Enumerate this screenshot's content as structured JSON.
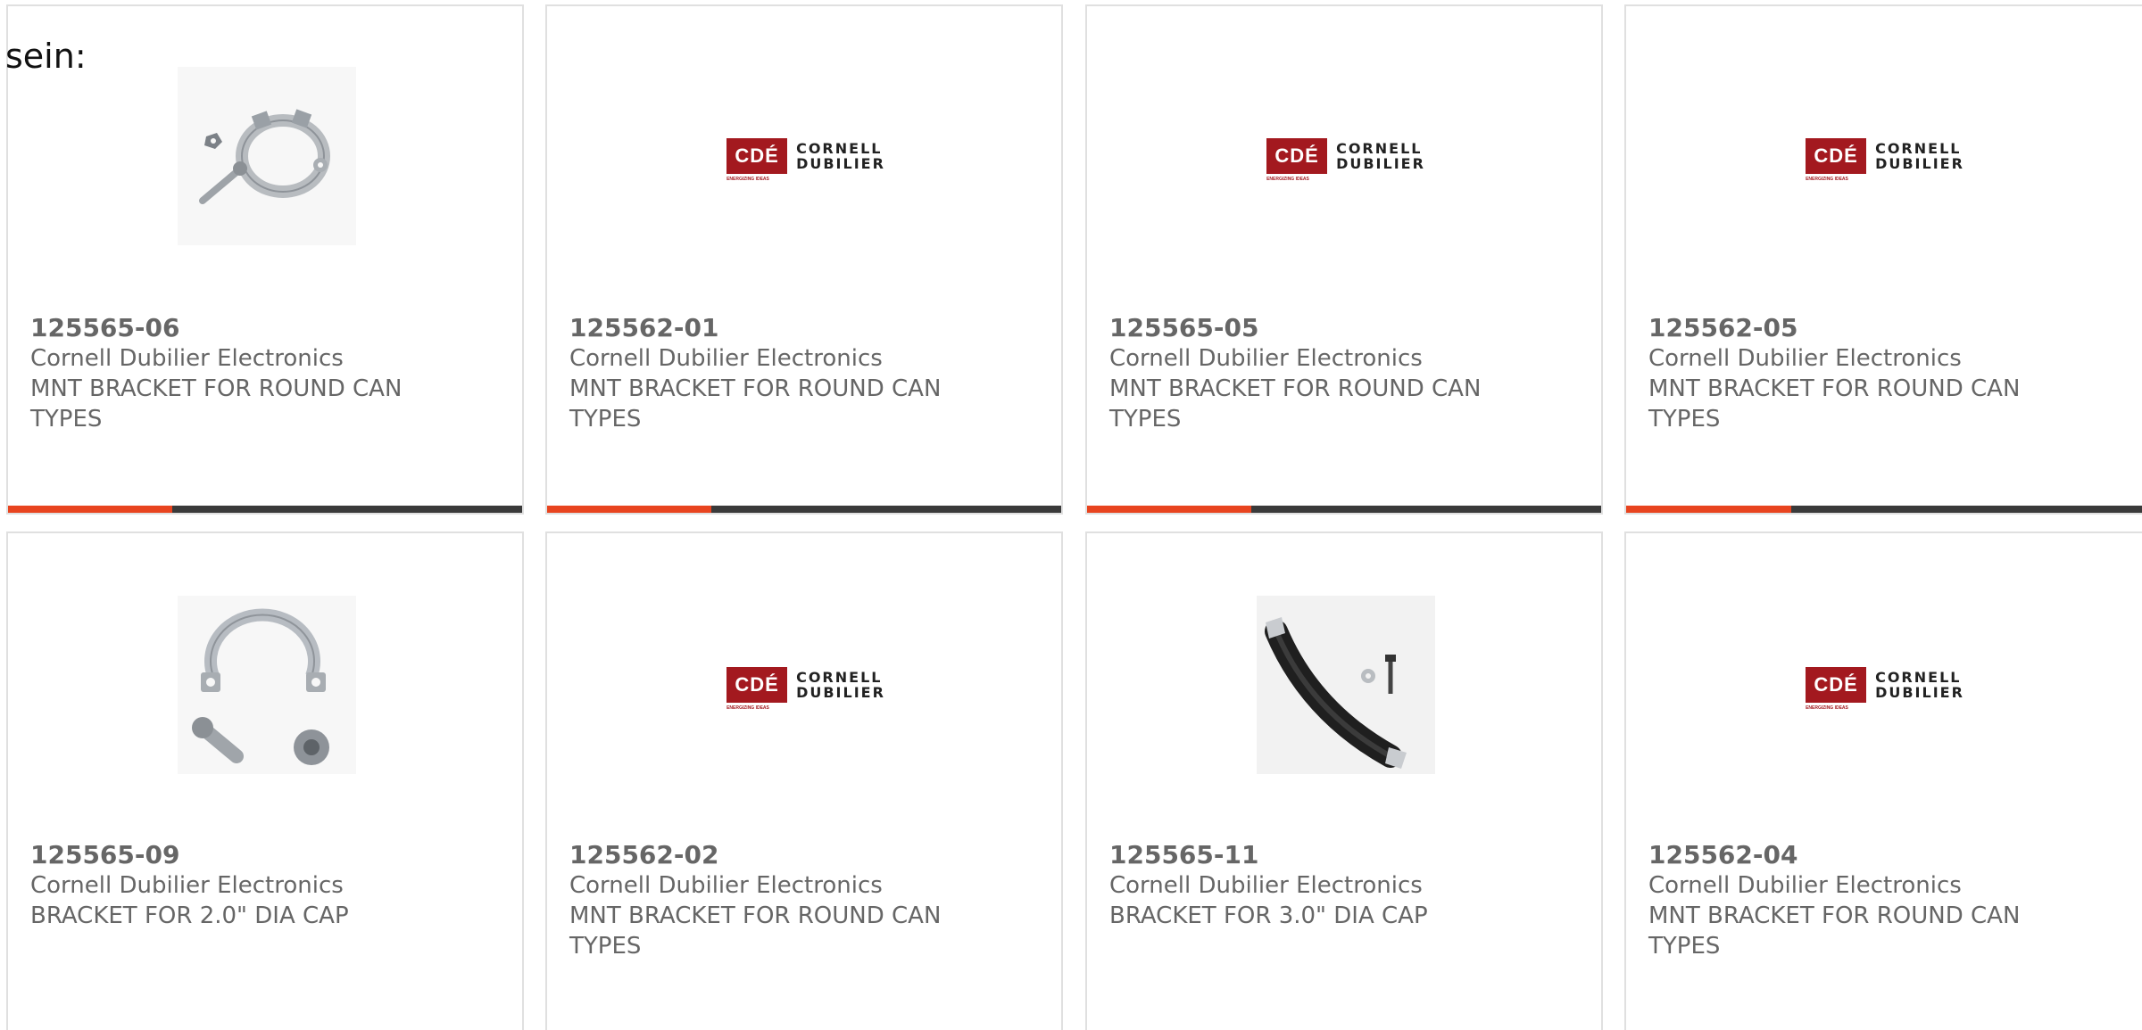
{
  "intro": "sein:",
  "colors": {
    "accent": "#e8441f",
    "track": "#3a3a3a",
    "cde_red": "#a3191f",
    "text_gray": "#666666"
  },
  "products": [
    {
      "part_number": "125565-06",
      "manufacturer": "Cornell Dubilier Electronics",
      "description": "MNT BRACKET FOR ROUND CAN TYPES",
      "image": "bracket-clamp-with-screw-photo",
      "progress": 0.32
    },
    {
      "part_number": "125562-01",
      "manufacturer": "Cornell Dubilier Electronics",
      "description": "MNT BRACKET FOR ROUND CAN TYPES",
      "image": "cde-logo",
      "logo": {
        "mark": "CDÉ",
        "line1": "CORNELL",
        "line2": "DUBILIER",
        "tagline": "ENERGIZING IDEAS"
      },
      "progress": 0.32
    },
    {
      "part_number": "125565-05",
      "manufacturer": "Cornell Dubilier Electronics",
      "description": "MNT BRACKET FOR ROUND CAN TYPES",
      "image": "cde-logo",
      "logo": {
        "mark": "CDÉ",
        "line1": "CORNELL",
        "line2": "DUBILIER",
        "tagline": "ENERGIZING IDEAS"
      },
      "progress": 0.32
    },
    {
      "part_number": "125562-05",
      "manufacturer": "Cornell Dubilier Electronics",
      "description": "MNT BRACKET FOR ROUND CAN TYPES",
      "image": "cde-logo",
      "logo": {
        "mark": "CDÉ",
        "line1": "CORNELL",
        "line2": "DUBILIER",
        "tagline": "ENERGIZING IDEAS"
      },
      "progress": 0.32
    },
    {
      "part_number": "125565-09",
      "manufacturer": "Cornell Dubilier Electronics",
      "description": "BRACKET FOR 2.0\" DIA CAP",
      "image": "bracket-clamp-with-screw-and-nut-photo"
    },
    {
      "part_number": "125562-02",
      "manufacturer": "Cornell Dubilier Electronics",
      "description": "MNT BRACKET FOR ROUND CAN TYPES",
      "image": "cde-logo",
      "logo": {
        "mark": "CDÉ",
        "line1": "CORNELL",
        "line2": "DUBILIER",
        "tagline": "ENERGIZING IDEAS"
      }
    },
    {
      "part_number": "125565-11",
      "manufacturer": "Cornell Dubilier Electronics",
      "description": "BRACKET FOR 3.0\" DIA CAP",
      "image": "black-bracket-clamp-photo"
    },
    {
      "part_number": "125562-04",
      "manufacturer": "Cornell Dubilier Electronics",
      "description": "MNT BRACKET FOR ROUND CAN TYPES",
      "image": "cde-logo",
      "logo": {
        "mark": "CDÉ",
        "line1": "CORNELL",
        "line2": "DUBILIER",
        "tagline": "ENERGIZING IDEAS"
      }
    }
  ]
}
